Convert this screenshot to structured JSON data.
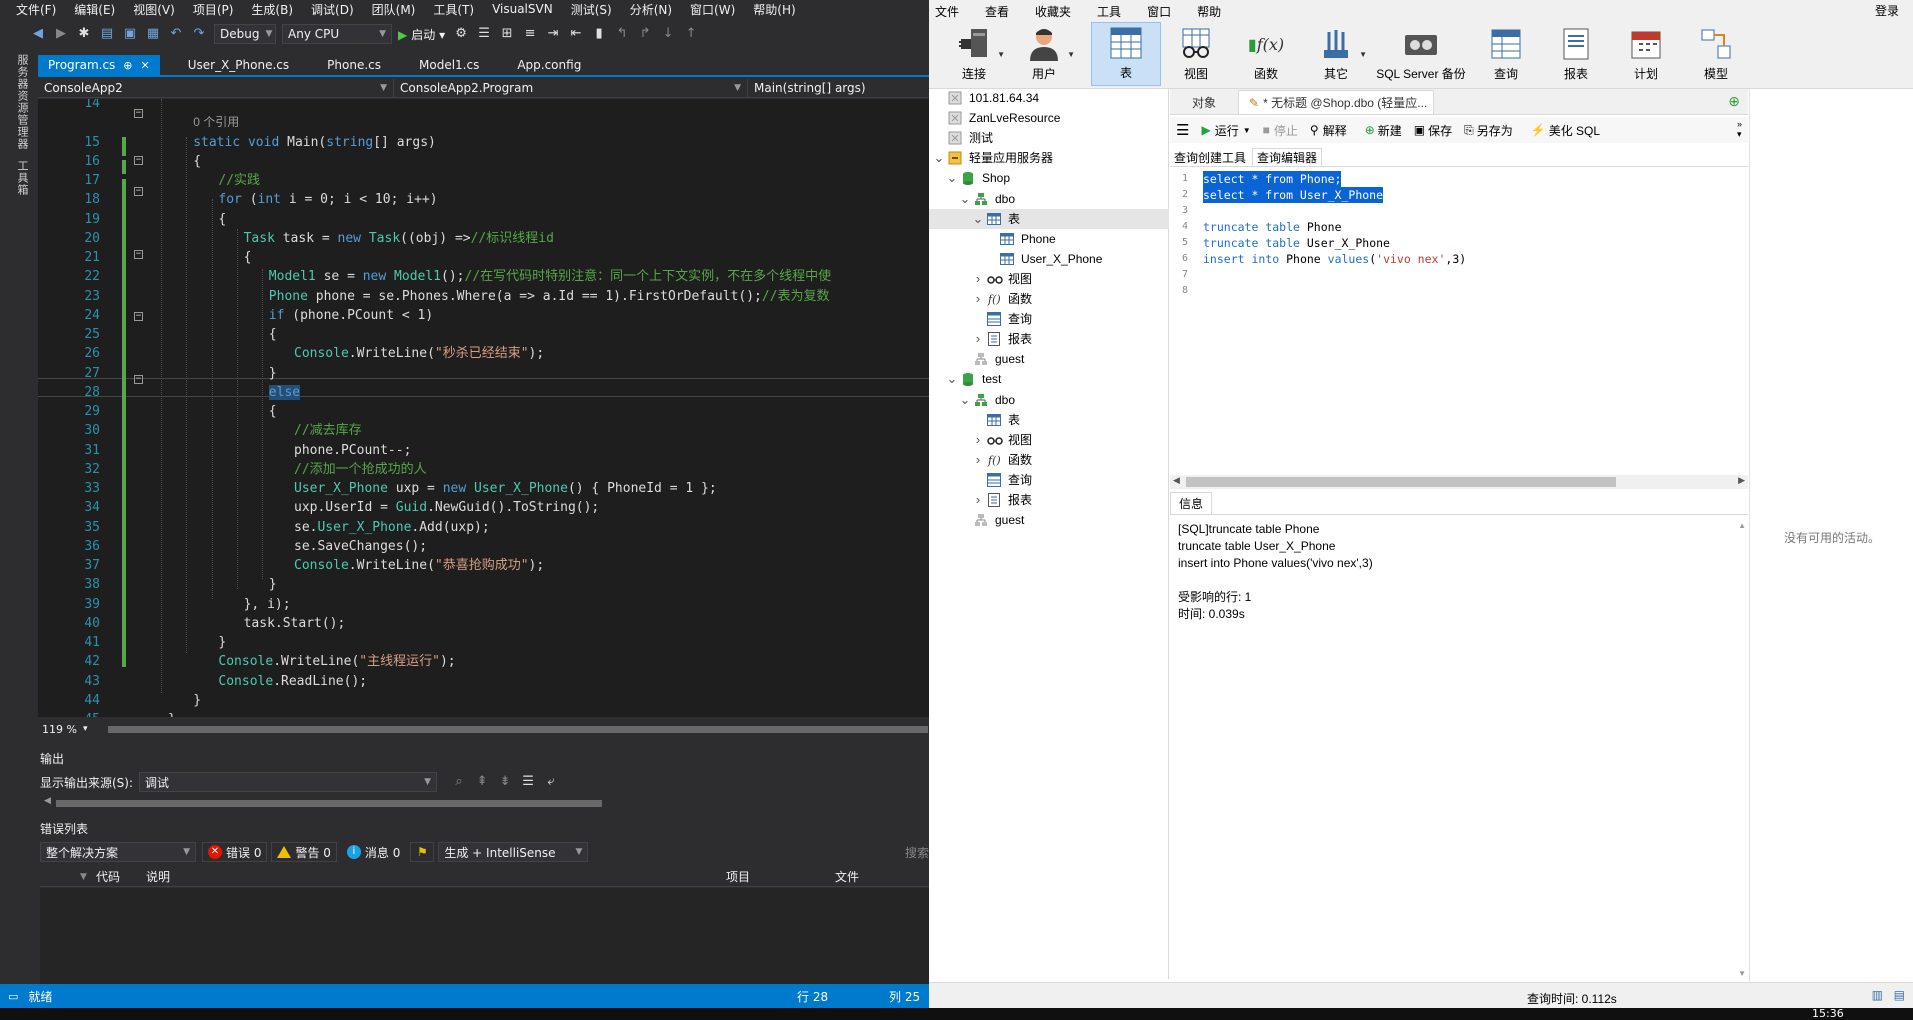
{
  "vs": {
    "menu": [
      "文件(F)",
      "编辑(E)",
      "视图(V)",
      "项目(P)",
      "生成(B)",
      "调试(D)",
      "团队(M)",
      "工具(T)",
      "VisualSVN",
      "测试(S)",
      "分析(N)",
      "窗口(W)",
      "帮助(H)"
    ],
    "toolbar": {
      "config": "Debug",
      "platform": "Any CPU",
      "start": "启动"
    },
    "side_panels": [
      "服务器资源管理器",
      "工具箱"
    ],
    "tabs": [
      {
        "label": "Program.cs",
        "active": true,
        "pin": "⊕",
        "close": "✕"
      },
      {
        "label": "User_X_Phone.cs"
      },
      {
        "label": "Phone.cs"
      },
      {
        "label": "Model1.cs"
      },
      {
        "label": "App.config"
      }
    ],
    "navbar": {
      "project": "ConsoleApp2",
      "class": "ConsoleApp2.Program",
      "member": "Main(string[] args)"
    },
    "code_lines": [
      {
        "n": "14",
        "text": ""
      },
      {
        "n": "",
        "text": "0 个引用"
      },
      {
        "n": "15",
        "text": "static void Main(string[] args)"
      },
      {
        "n": "16",
        "text": "{"
      },
      {
        "n": "17",
        "text": "//实践"
      },
      {
        "n": "18",
        "text": "for (int i = 0; i < 10; i++)"
      },
      {
        "n": "19",
        "text": "{"
      },
      {
        "n": "20",
        "text": "Task task = new Task((obj) =>//标识线程id"
      },
      {
        "n": "21",
        "text": "{"
      },
      {
        "n": "22",
        "text": "Model1 se = new Model1();//在写代码时特别注意：同一个上下文实例，不在多个线程中使"
      },
      {
        "n": "23",
        "text": "Phone phone = se.Phones.Where(a => a.Id == 1).FirstOrDefault();//表为复数"
      },
      {
        "n": "24",
        "text": "if (phone.PCount < 1)"
      },
      {
        "n": "25",
        "text": "{"
      },
      {
        "n": "26",
        "text": "Console.WriteLine(\"秒杀已经结束\");"
      },
      {
        "n": "27",
        "text": "}"
      },
      {
        "n": "28",
        "text": "else"
      },
      {
        "n": "29",
        "text": "{"
      },
      {
        "n": "30",
        "text": "//减去库存"
      },
      {
        "n": "31",
        "text": "phone.PCount--;"
      },
      {
        "n": "32",
        "text": "//添加一个抢成功的人"
      },
      {
        "n": "33",
        "text": "User_X_Phone uxp = new User_X_Phone() { PhoneId = 1 };"
      },
      {
        "n": "34",
        "text": "uxp.UserId = Guid.NewGuid().ToString();"
      },
      {
        "n": "35",
        "text": "se.User_X_Phone.Add(uxp);"
      },
      {
        "n": "36",
        "text": "se.SaveChanges();"
      },
      {
        "n": "37",
        "text": "Console.WriteLine(\"恭喜抢购成功\");"
      },
      {
        "n": "38",
        "text": "}"
      },
      {
        "n": "39",
        "text": "}, i);"
      },
      {
        "n": "40",
        "text": "task.Start();"
      },
      {
        "n": "41",
        "text": "}"
      },
      {
        "n": "42",
        "text": "Console.WriteLine(\"主线程运行\");"
      },
      {
        "n": "43",
        "text": "Console.ReadLine();"
      },
      {
        "n": "44",
        "text": "}"
      },
      {
        "n": "45",
        "text": "}"
      }
    ],
    "zoom": "119 %",
    "output": {
      "title": "输出",
      "source_label": "显示输出来源(S):",
      "source_value": "调试"
    },
    "error_list": {
      "title": "错误列表",
      "scope": "整个解决方案",
      "errors": "错误 0",
      "warnings": "警告 0",
      "messages": "消息 0",
      "build_filter": "生成 + IntelliSense",
      "search": "搜索",
      "columns": [
        "代码",
        "说明",
        "项目",
        "文件"
      ]
    },
    "status": {
      "ready": "就绪",
      "line": "行 28",
      "col": "列 25"
    }
  },
  "navicat": {
    "menu": [
      "文件",
      "查看",
      "收藏夹",
      "工具",
      "窗口",
      "帮助"
    ],
    "login": "登录",
    "ribbon": [
      {
        "label": "连接",
        "icon": "plug-icon"
      },
      {
        "label": "用户",
        "icon": "user-icon"
      },
      {
        "label": "表",
        "icon": "table-icon",
        "active": true
      },
      {
        "label": "视图",
        "icon": "glasses-icon"
      },
      {
        "label": "函数",
        "icon": "function-icon",
        "glyph": "f(x)"
      },
      {
        "label": "其它",
        "icon": "tools-icon"
      },
      {
        "label": "SQL Server 备份",
        "icon": "backup-icon"
      },
      {
        "label": "查询",
        "icon": "query-icon"
      },
      {
        "label": "报表",
        "icon": "report-icon"
      },
      {
        "label": "计划",
        "icon": "calendar-icon"
      },
      {
        "label": "模型",
        "icon": "model-icon"
      }
    ],
    "tree": [
      {
        "label": "101.81.64.34",
        "level": 0,
        "icon": "server"
      },
      {
        "label": "ZanLveResource",
        "level": 0,
        "icon": "server"
      },
      {
        "label": "测试",
        "level": 0,
        "icon": "server"
      },
      {
        "label": "轻量应用服务器",
        "level": 0,
        "icon": "server-open",
        "toggle": "v"
      },
      {
        "label": "Shop",
        "level": 1,
        "icon": "database",
        "toggle": "v"
      },
      {
        "label": "dbo",
        "level": 2,
        "icon": "schema",
        "toggle": "v"
      },
      {
        "label": "表",
        "level": 3,
        "icon": "table",
        "toggle": "v",
        "selected": true
      },
      {
        "label": "Phone",
        "level": 4,
        "icon": "table"
      },
      {
        "label": "User_X_Phone",
        "level": 4,
        "icon": "table"
      },
      {
        "label": "视图",
        "level": 3,
        "icon": "view",
        "toggle": ">"
      },
      {
        "label": "函数",
        "level": 3,
        "icon": "function",
        "toggle": ">"
      },
      {
        "label": "查询",
        "level": 3,
        "icon": "query"
      },
      {
        "label": "报表",
        "level": 3,
        "icon": "report",
        "toggle": ">"
      },
      {
        "label": "guest",
        "level": 2,
        "icon": "schema-gray"
      },
      {
        "label": "test",
        "level": 1,
        "icon": "database",
        "toggle": "v"
      },
      {
        "label": "dbo",
        "level": 2,
        "icon": "schema",
        "toggle": "v"
      },
      {
        "label": "表",
        "level": 3,
        "icon": "table"
      },
      {
        "label": "视图",
        "level": 3,
        "icon": "view",
        "toggle": ">"
      },
      {
        "label": "函数",
        "level": 3,
        "icon": "function",
        "toggle": ">"
      },
      {
        "label": "查询",
        "level": 3,
        "icon": "query"
      },
      {
        "label": "报表",
        "level": 3,
        "icon": "report",
        "toggle": ">"
      },
      {
        "label": "guest",
        "level": 2,
        "icon": "schema-gray"
      }
    ],
    "tabs": [
      {
        "label": "对象"
      },
      {
        "label": "* 无标题 @Shop.dbo (轻量应...",
        "active": true
      }
    ],
    "query_toolbar": {
      "run": "运行",
      "stop": "停止",
      "explain": "解释",
      "new": "新建",
      "save": "保存",
      "save_as": "另存为",
      "beautify": "美化 SQL"
    },
    "subtabs": [
      "查询创建工具",
      "查询编辑器"
    ],
    "sql_lines": [
      {
        "n": "1",
        "text": "select * from Phone;",
        "selected": true
      },
      {
        "n": "2",
        "text": "select * from User_X_Phone",
        "selected": true
      },
      {
        "n": "3",
        "text": ""
      },
      {
        "n": "4",
        "text": "truncate table Phone"
      },
      {
        "n": "5",
        "text": "truncate table User_X_Phone"
      },
      {
        "n": "6",
        "text": "insert into Phone values('vivo nex',3)"
      },
      {
        "n": "7",
        "text": ""
      },
      {
        "n": "8",
        "text": ""
      }
    ],
    "info_tab": "信息",
    "info_lines": [
      "[SQL]truncate table Phone",
      "truncate table User_X_Phone",
      "insert into Phone values('vivo nex',3)",
      "",
      "受影响的行: 1",
      "时间: 0.039s"
    ],
    "no_activity": "没有可用的活动。",
    "status_query_time": "查询时间: 0.112s"
  },
  "taskbar": {
    "clock": "15:36"
  }
}
